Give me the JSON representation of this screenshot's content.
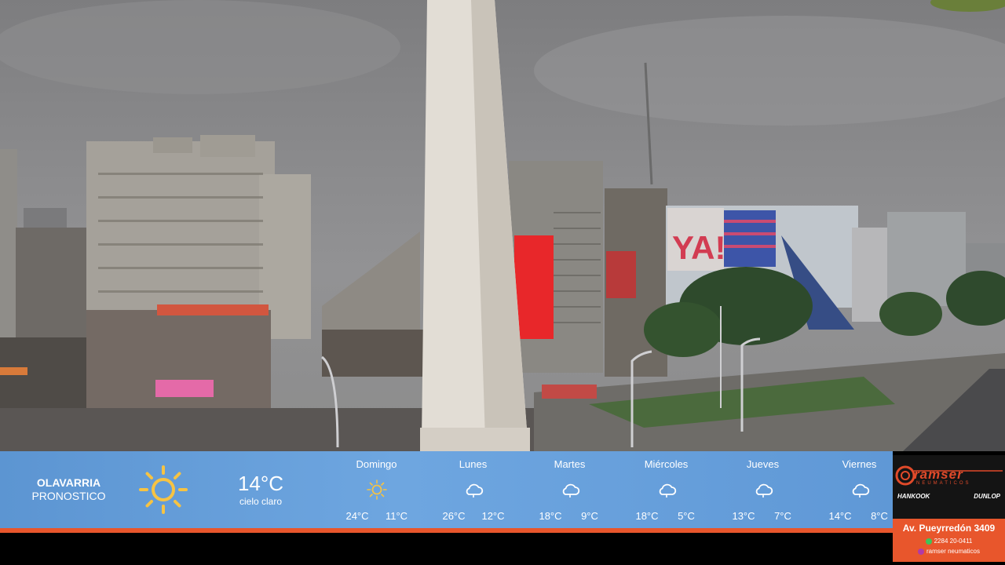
{
  "location": {
    "city": "OLAVARRIA",
    "subtitle": "PRONOSTICO"
  },
  "current": {
    "temp": "14°C",
    "description": "cielo claro",
    "icon": "sun-icon"
  },
  "forecast": [
    {
      "day": "Domingo",
      "max": "24°C",
      "min": "11°C",
      "icon": "sun-icon"
    },
    {
      "day": "Lunes",
      "max": "26°C",
      "min": "12°C",
      "icon": "cloud-icon"
    },
    {
      "day": "Martes",
      "max": "18°C",
      "min": "9°C",
      "icon": "cloud-icon"
    },
    {
      "day": "Miércoles",
      "max": "18°C",
      "min": "5°C",
      "icon": "cloud-icon"
    },
    {
      "day": "Jueves",
      "max": "13°C",
      "min": "7°C",
      "icon": "cloud-icon"
    },
    {
      "day": "Viernes",
      "max": "14°C",
      "min": "8°C",
      "icon": "cloud-icon"
    }
  ],
  "sponsor": {
    "brand": "ramser",
    "tagline": "NEUMATICOS",
    "partners": [
      "HANKOOK",
      "DUNLOP"
    ],
    "address": "Av. Pueyrredón 3409",
    "phone": "2284 20-0411",
    "social": "ramser neumaticos"
  },
  "scene": {
    "billboard_text": "YA!"
  },
  "colors": {
    "bar_blue": "#6ea6e0",
    "accent_orange": "#e8562c",
    "sun_yellow": "#f6c343"
  }
}
